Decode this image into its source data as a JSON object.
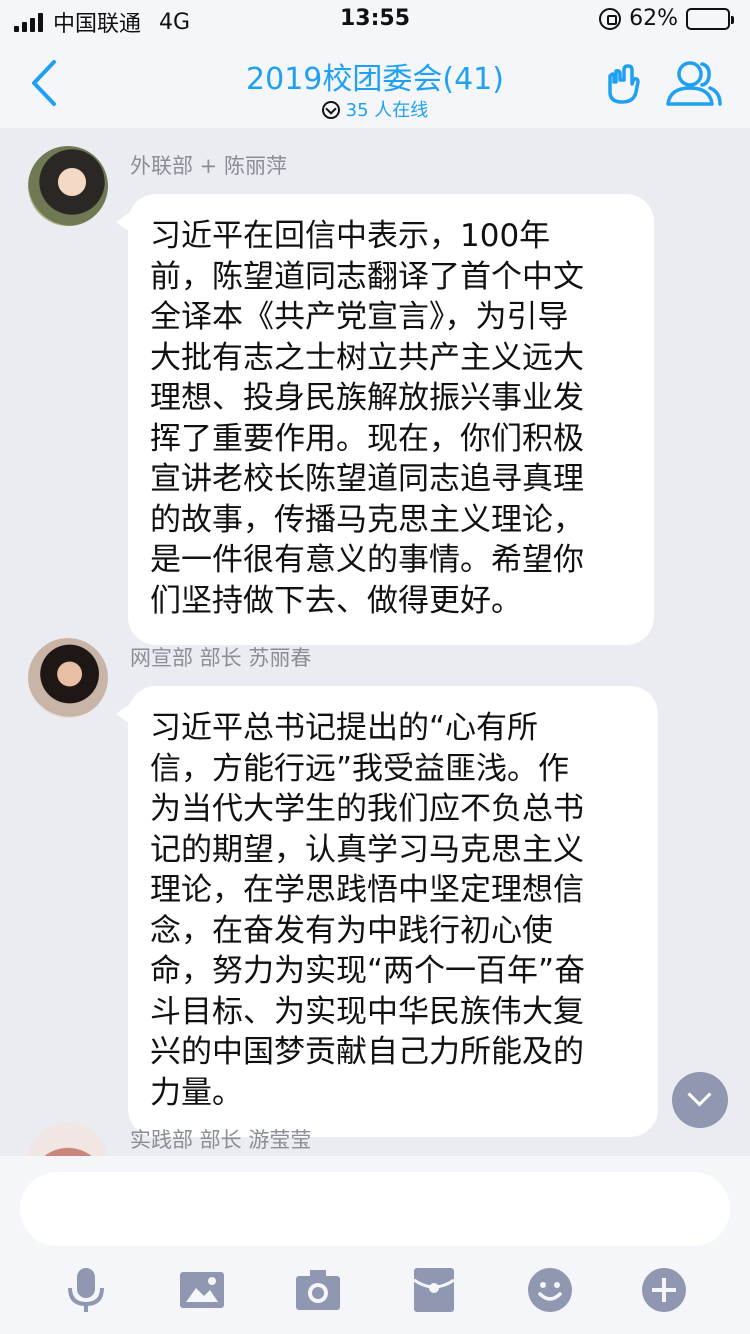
{
  "status_bar": {
    "carrier": "中国联通",
    "network": "4G",
    "time": "13:55",
    "battery_percent": "62%",
    "battery_level": 0.62,
    "icons": [
      "signal-icon",
      "orientation-lock-icon",
      "battery-charging-icon"
    ]
  },
  "header": {
    "title": "2019校团委会(41)",
    "online": "35 人在线",
    "icons": [
      "back-chevron-icon",
      "online-status-icon",
      "gesture-hand-icon",
      "group-members-icon"
    ]
  },
  "messages": [
    {
      "sender": "外联部 + 陈丽萍",
      "lines": [
        "习近平在回信中表示，100年",
        "前，陈望道同志翻译了首个中文",
        "全译本《共产党宣言》，为引导",
        "大批有志之士树立共产主义远大",
        "理想、投身民族解放振兴事业发",
        "挥了重要作用。现在，你们积极",
        "宣讲老校长陈望道同志追寻真理",
        "的故事，传播马克思主义理论，",
        "是一件很有意义的事情。希望你",
        "们坚持做下去、做得更好。"
      ]
    },
    {
      "sender": "网宣部 部长 苏丽春",
      "lines": [
        "习近平总书记提出的“心有所",
        "信，方能行远”我受益匪浅。作",
        "为当代大学生的我们应不负总书",
        "记的期望，认真学习马克思主义",
        "理论，在学思践悟中坚定理想信",
        "念，在奋发有为中践行初心使",
        "命，努力为实现“两个一百年”奋",
        "斗目标、为实现中华民族伟大复",
        "兴的中国梦贡献自己力所能及的",
        "力量。"
      ]
    },
    {
      "sender": "实践部 部长 游莹莹",
      "lines": []
    }
  ],
  "composer": {
    "input_value": "",
    "tools": [
      "microphone-icon",
      "image-icon",
      "camera-icon",
      "red-packet-icon",
      "emoji-icon",
      "plus-icon"
    ]
  },
  "colors": {
    "accent": "#1ea1f2",
    "background": "#ebecf1",
    "bar": "#f5f6fa",
    "icon_gray": "#8f98b0",
    "sender_gray": "#8a8e96"
  }
}
